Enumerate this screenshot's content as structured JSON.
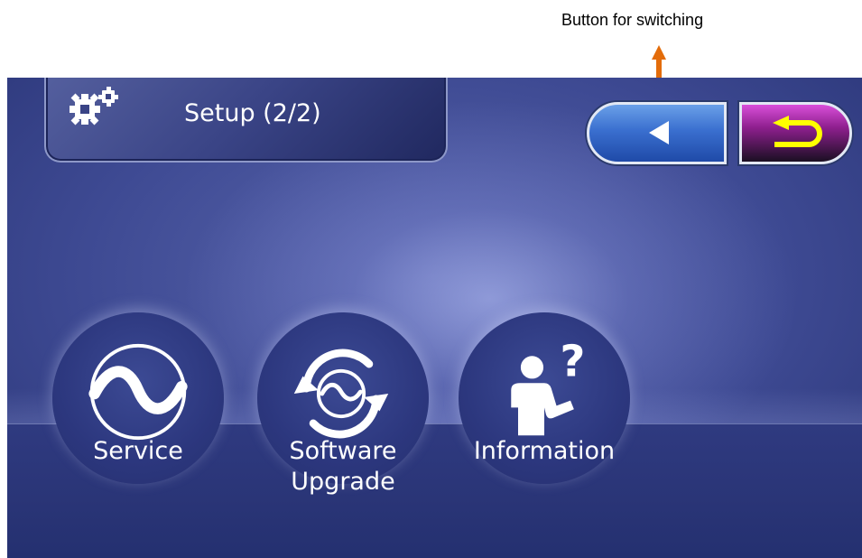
{
  "annotation": {
    "text": "Button for switching",
    "arrow_color": "#e36c0a"
  },
  "header": {
    "title": "Setup (2/2)",
    "title_icon": "gears-icon",
    "switch_button_icon": "back-arrow-icon",
    "return_button_icon": "return-arrow-icon"
  },
  "menu": [
    {
      "label": "Service",
      "icon": "service-wave-icon"
    },
    {
      "label": "Software\nUpgrade",
      "icon": "software-upgrade-icon"
    },
    {
      "label": "Information",
      "icon": "information-person-icon"
    }
  ],
  "colors": {
    "screen_background": "#3e4a93",
    "switch_button": "#3a6fcf",
    "return_button": "#8e1f8e",
    "return_arrow": "#ffff00",
    "annotation_arrow": "#e36c0a"
  }
}
